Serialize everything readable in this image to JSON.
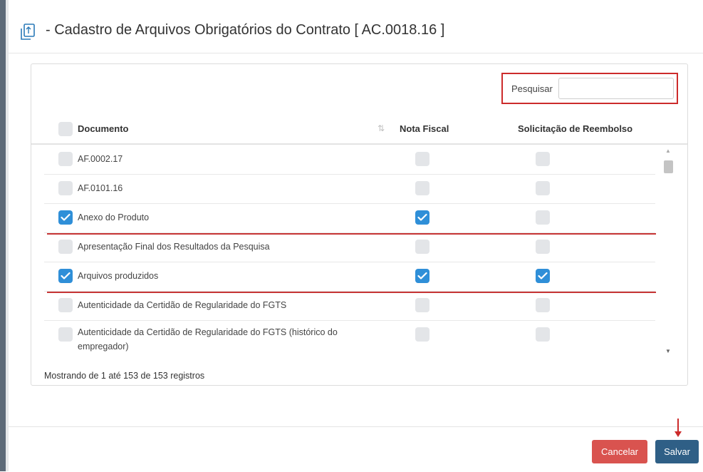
{
  "modal": {
    "title": "-  Cadastro de Arquivos Obrigatórios do Contrato [ AC.0018.16 ]",
    "icon": "copy-documents-icon"
  },
  "search": {
    "label": "Pesquisar",
    "value": "",
    "placeholder": ""
  },
  "table": {
    "columns": {
      "documento": "Documento",
      "nota_fiscal": "Nota Fiscal",
      "reembolso": "Solicitação de Reembolso"
    },
    "header_checked": false,
    "rows": [
      {
        "documento": "AF.0002.17",
        "selected": false,
        "nota_fiscal": false,
        "reembolso": false
      },
      {
        "documento": "AF.0101.16",
        "selected": false,
        "nota_fiscal": false,
        "reembolso": false
      },
      {
        "documento": "Anexo do Produto",
        "selected": true,
        "nota_fiscal": true,
        "reembolso": false
      },
      {
        "documento": "Apresentação Final dos Resultados da Pesquisa",
        "selected": false,
        "nota_fiscal": false,
        "reembolso": false
      },
      {
        "documento": "Arquivos produzidos",
        "selected": true,
        "nota_fiscal": true,
        "reembolso": true
      },
      {
        "documento": "Autenticidade da Certidão de Regularidade do FGTS",
        "selected": false,
        "nota_fiscal": false,
        "reembolso": false
      },
      {
        "documento": "Autenticidade da Certidão de Regularidade do FGTS (histórico do empregador)",
        "selected": false,
        "nota_fiscal": false,
        "reembolso": false
      }
    ],
    "info": "Mostrando de 1 até 153 de 153 registros"
  },
  "footer": {
    "cancel_label": "Cancelar",
    "save_label": "Salvar"
  },
  "colors": {
    "checked": "#2f8fd8",
    "unchecked": "#e3e5e8",
    "highlight": "#cc2b2b",
    "cancel": "#d9534f",
    "save": "#2f5f86"
  }
}
